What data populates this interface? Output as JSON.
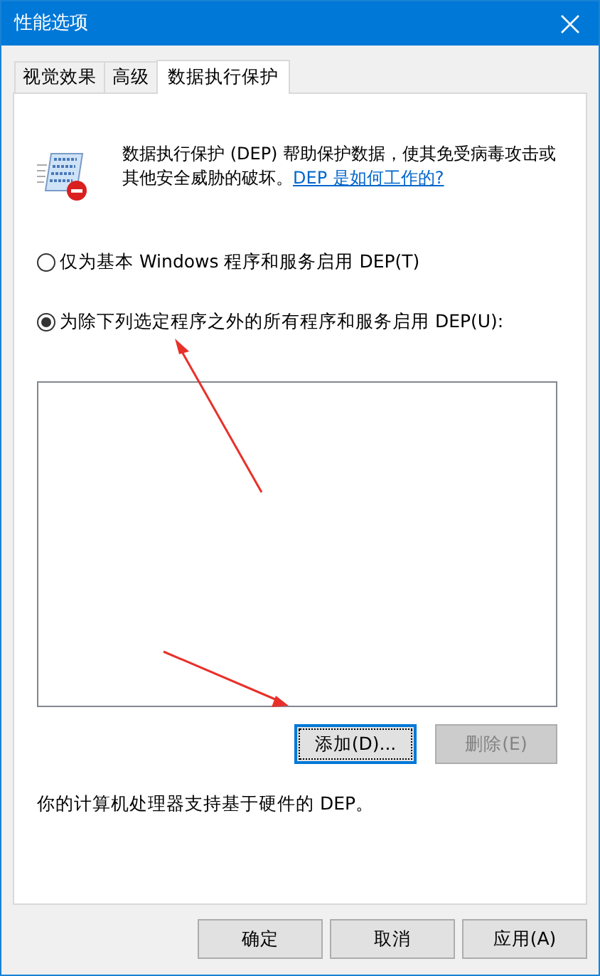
{
  "window": {
    "title": "性能选项"
  },
  "tabs": [
    {
      "label": "视觉效果",
      "selected": false
    },
    {
      "label": "高级",
      "selected": false
    },
    {
      "label": "数据执行保护",
      "selected": true
    }
  ],
  "description": {
    "text": "数据执行保护 (DEP) 帮助保护数据，使其免受病毒攻击或其他安全威胁的破坏。",
    "link": "DEP 是如何工作的?"
  },
  "options": [
    {
      "label": "仅为基本 Windows 程序和服务启用 DEP(T)",
      "selected": false
    },
    {
      "label": "为除下列选定程序之外的所有程序和服务启用 DEP(U):",
      "selected": true
    }
  ],
  "list_buttons": [
    {
      "label": "添加(D)...",
      "focused": true,
      "disabled": false
    },
    {
      "label": "删除(E)",
      "focused": false,
      "disabled": true
    }
  ],
  "status": "你的计算机处理器支持基于硬件的 DEP。",
  "buttons": [
    {
      "label": "确定",
      "disabled": false
    },
    {
      "label": "取消",
      "disabled": false
    },
    {
      "label": "应用(A)",
      "disabled": false
    }
  ]
}
